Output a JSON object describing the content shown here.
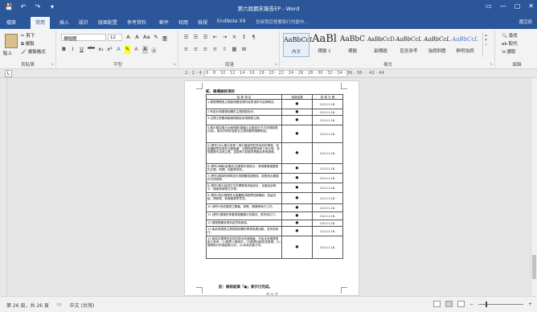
{
  "app": {
    "window_title": "第六屆期末報告EP - Word",
    "tell_me": "告訴我您想要執行的動作...",
    "account": "蕭亞辰",
    "window_buttons": [
      "▭",
      "—",
      "▢",
      "✕"
    ]
  },
  "quick_access": [
    "💾",
    "↶",
    "↷",
    "▾"
  ],
  "tabs": [
    "檔案",
    "常用",
    "插入",
    "設計",
    "版面配置",
    "參考資料",
    "郵件",
    "校閱",
    "檢視",
    "EndNote X9"
  ],
  "active_tab": "常用",
  "ribbon": {
    "clipboard": {
      "label": "剪貼簿",
      "paste": "貼上",
      "cut": "✂ 剪下",
      "copy": "⧉ 複製",
      "format_painter": "🖌 複製格式"
    },
    "font": {
      "label": "字型",
      "font_name": "標楷體",
      "font_size": "12",
      "row1": [
        "A",
        "A",
        "Aa",
        "✎",
        "亜"
      ],
      "row2": [
        "B",
        "I",
        "U",
        "abc",
        "x₂",
        "x²",
        "A",
        "✎",
        "A",
        "A",
        "Ⓐ"
      ]
    },
    "paragraph": {
      "label": "段落",
      "row1": [
        "☰",
        "☰",
        "☰",
        "⇤",
        "⇥",
        "✕",
        "↕",
        "¶"
      ],
      "row2": [
        "≡",
        "≡",
        "≡",
        "≡",
        "⇳",
        "▦",
        "⊞"
      ]
    },
    "styles": {
      "label": "樣式",
      "items": [
        {
          "sample": "AaBbCcI",
          "name": "內文"
        },
        {
          "sample": "AaBl",
          "name": "標題 1"
        },
        {
          "sample": "AaBbC",
          "name": "標題"
        },
        {
          "sample": "AaBbCcD",
          "name": "副標題"
        },
        {
          "sample": "AaBbCcL",
          "name": "區別參考"
        },
        {
          "sample": "AaBbCcL",
          "name": "強調斜體"
        },
        {
          "sample": "AaBbCcL",
          "name": "鮮明強調"
        }
      ]
    },
    "editing": {
      "label": "編輯",
      "find": "🔍 尋找",
      "replace": "ab 取代",
      "select": "⇲ 選取"
    }
  },
  "ruler": {
    "tab_selector": "L",
    "numbers": "2 · 2 · 4 · 6 · 8 · 10 · 12 · 14 · 16 · 18 · 20 · 22 · 24 · 26 · 28 · 30 · 32 · 34 · 36 · 38 · · 42 · 44"
  },
  "document": {
    "heading": "貳、展場檢核項目",
    "columns": [
      "檢 核 項 目",
      "檢核結果",
      "檢 核 日 期"
    ],
    "rows": [
      {
        "item": "1.展覽標題與主題能明確呈現所欲表達的內容與概念。",
        "result": "●",
        "date": "110.11.18."
      },
      {
        "item": "2.有設計與展覽相關的主題視覺設計。",
        "result": "●",
        "date": "110.11.18."
      },
      {
        "item": "3.空間之配置與動線規劃能呈現展覽主題。",
        "result": "●",
        "date": "110.11.18."
      },
      {
        "item": "4.展示櫃及展示台面規劃(建議以互動設計方式呈現展覽內容)，展示的物件能配合主題與觀眾展開對話。",
        "result": "●",
        "date": "110.11.18."
      },
      {
        "item": "5.(實作)可以展示成員一週中讓我們記憶深刻的事物，或能讓觀眾探索的互動裝置，如展覽導覽說明之設計等，呈現展覽內容與主題，並能夠引起觀眾興趣及參與展覽。",
        "result": "●",
        "date": "110.11.18."
      },
      {
        "item": "6.(實作)海報(宣傳品)及展覽手冊設計，有明確傳達展覽的主題、時間、地點等資訊。",
        "result": "●",
        "date": "110.11.18."
      },
      {
        "item": "7.(實作)展場的照明設計與整體氛圍營造，能營造出觀展的沉浸感受。",
        "result": "●",
        "date": "110.11.18."
      },
      {
        "item": "8.(實作)展示說明文字的撰寫與排版設計，含展品說明卡、展板與導覽文字等。",
        "result": "●",
        "date": "110.11.18."
      },
      {
        "item": "9.(實作)設計展覽的互動體驗或觀眾回饋機制，如留言板、問卷等，能蒐集觀眾意見。",
        "result": "●",
        "date": "110.11.18."
      },
      {
        "item": "10.(實作)完成展覽之開幕、導覽、撤展等執行工作。",
        "result": "●",
        "date": "110.11.18."
      },
      {
        "item": "11.(實作)展場的佈置與整體展示效果佳，具有吸引力。",
        "result": "●",
        "date": "110.11.18."
      },
      {
        "item": "12.展覽整體呈現有創意與美感。",
        "result": "●",
        "date": "110.11.18."
      },
      {
        "item": "13.能依據展覽主題規劃相關的教育推廣活動，並有效執行。",
        "result": "●",
        "date": "110.11.18."
      },
      {
        "item": "14.能檢討展覽的成效並提出改進建議，作為未來展覽規劃之參考。(1)觀眾人數統計；(2)觀眾回饋意見整理；(3)展覽執行的優缺點分析；(4)未來改善方向。",
        "result": "●",
        "date": "110.11.18."
      }
    ],
    "footer_note": "註：檢核結果「●」表示已完成。",
    "page_footer": "第 26 頁"
  },
  "status": {
    "page": "第 26 頁，共 26 頁",
    "language": "中文 (台灣)",
    "zoom": 40
  }
}
